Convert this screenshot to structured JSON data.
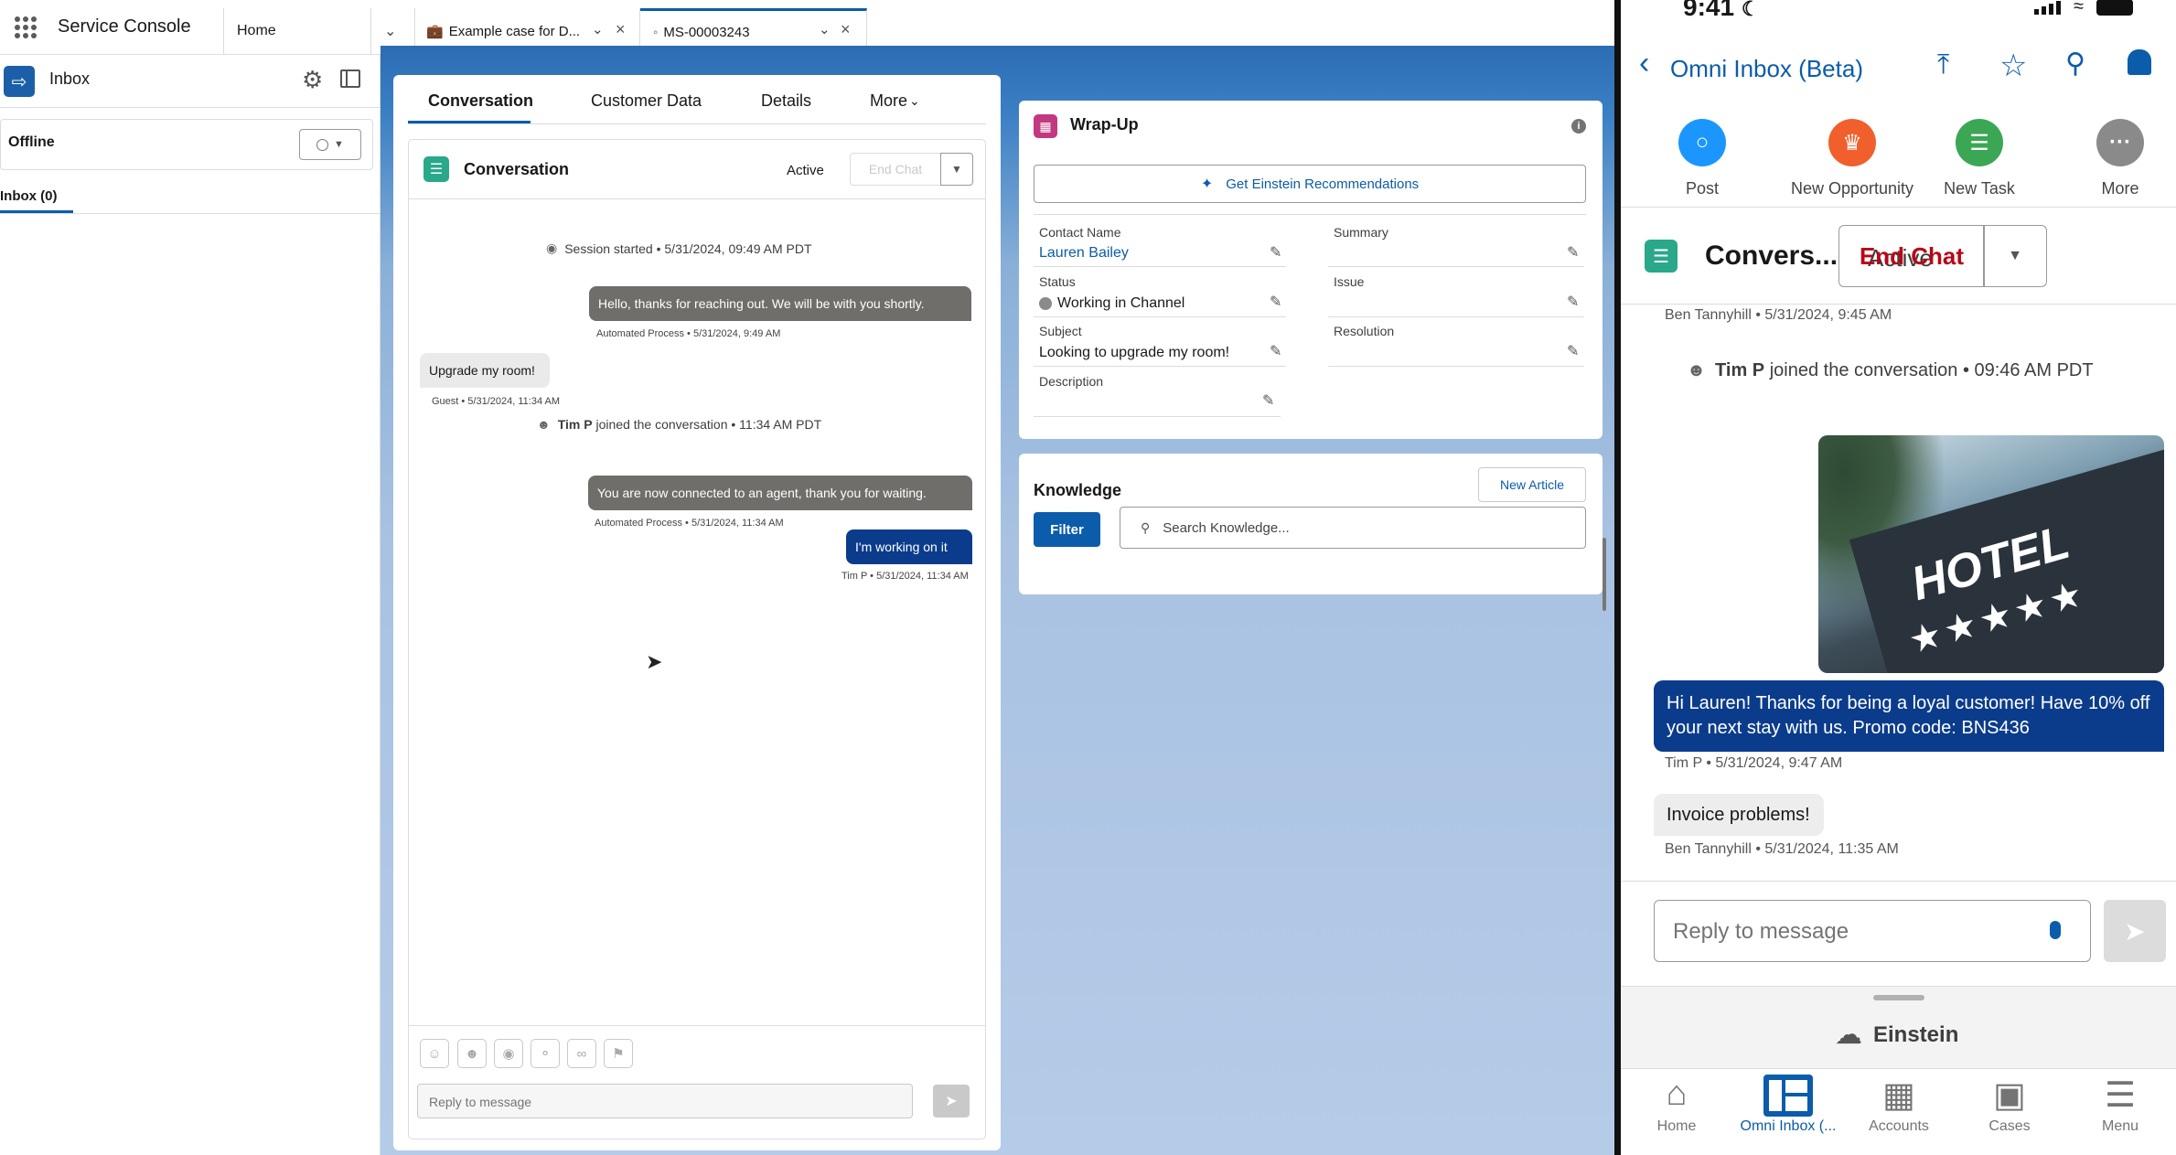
{
  "app": {
    "name": "Service Console"
  },
  "tabs": [
    {
      "label": "Home"
    },
    {
      "label": "Example case for D..."
    },
    {
      "label": "MS-00003243"
    }
  ],
  "utility": {
    "title": "Inbox",
    "status": "Offline",
    "inbox_tab": "Inbox (0)"
  },
  "conversation": {
    "tabs": [
      "Conversation",
      "Customer Data",
      "Details",
      "More"
    ],
    "header_title": "Conversation",
    "status": "Active",
    "end_chat": "End Chat",
    "session_started": "Session started • 5/31/2024, 09:49 AM PDT",
    "messages": [
      {
        "text": "Hello, thanks for reaching out. We will be with you shortly.",
        "meta": "Automated Process • 5/31/2024, 9:49 AM"
      },
      {
        "text": "Upgrade my room!",
        "meta": "Guest • 5/31/2024, 11:34 AM"
      },
      {
        "name": "Tim P",
        "event": " joined the conversation • 11:34 AM PDT"
      },
      {
        "text": "You are now connected to an agent, thank you for waiting.",
        "meta": "Automated Process • 5/31/2024, 11:34 AM"
      },
      {
        "text": "I'm working on it",
        "meta": "Tim P • 5/31/2024, 11:34 AM"
      }
    ],
    "reply_placeholder": "Reply to message"
  },
  "wrapup": {
    "title": "Wrap-Up",
    "einstein_button": "Get Einstein Recommendations",
    "fields": {
      "contact_name_label": "Contact Name",
      "contact_name": "Lauren Bailey",
      "status_label": "Status",
      "status": "Working in Channel",
      "subject_label": "Subject",
      "subject": "Looking to upgrade my room!",
      "description_label": "Description",
      "summary_label": "Summary",
      "issue_label": "Issue",
      "resolution_label": "Resolution"
    }
  },
  "knowledge": {
    "title": "Knowledge",
    "new_article": "New Article",
    "filter": "Filter",
    "search_placeholder": "Search Knowledge..."
  },
  "phone": {
    "time": "9:41",
    "back_title": "Omni Inbox (Beta)",
    "quick_actions": [
      "Post",
      "New Opportunity",
      "New Task",
      "More"
    ],
    "conv_title": "Convers...",
    "conv_status": "Active",
    "end_chat": "End Chat",
    "meta_top": "Ben Tannyhill • 5/31/2024, 9:45 AM",
    "joined_name": "Tim P",
    "joined_rest": " joined the conversation • 09:46 AM PDT",
    "image_text": "HOTEL",
    "promo_message": "Hi Lauren! Thanks for being a loyal customer! Have 10% off your next stay with us. Promo code: BNS436",
    "promo_meta": "Tim P • 5/31/2024, 9:47 AM",
    "customer_message": "Invoice problems!",
    "customer_meta": "Ben Tannyhill • 5/31/2024, 11:35 AM",
    "reply_placeholder": "Reply to message",
    "einstein": "Einstein",
    "nav": [
      "Home",
      "Omni Inbox (...",
      "Accounts",
      "Cases",
      "Menu"
    ]
  }
}
